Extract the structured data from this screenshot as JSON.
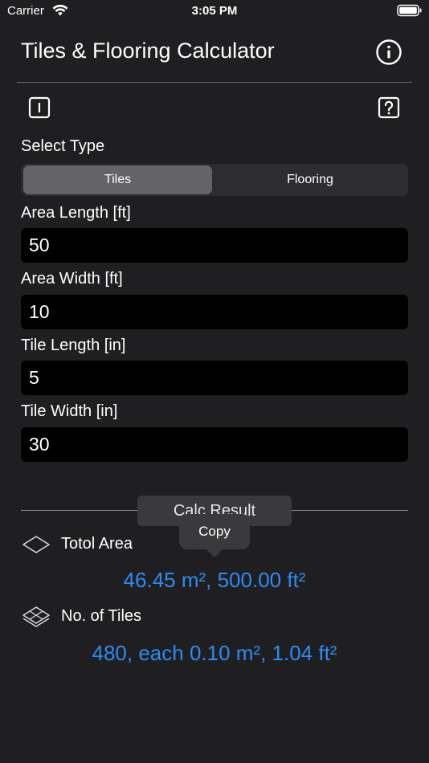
{
  "status_bar": {
    "carrier": "Carrier",
    "time": "3:05 PM"
  },
  "nav": {
    "title": "Tiles & Flooring Calculator",
    "info_icon": "info-icon"
  },
  "toolbar": {
    "left_icon": "text-cursor-box-icon",
    "right_icon": "question-box-icon"
  },
  "type_selector": {
    "label": "Select Type",
    "options": [
      "Tiles",
      "Flooring"
    ],
    "selected": "Tiles"
  },
  "fields": [
    {
      "label": "Area Length [ft]",
      "value": "50"
    },
    {
      "label": "Area Width [ft]",
      "value": "10"
    },
    {
      "label": "Tile Length [in]",
      "value": "5"
    },
    {
      "label": "Tile Width [in]",
      "value": "30"
    }
  ],
  "result": {
    "button_label": "Calc Result",
    "copy_tooltip": "Copy",
    "total_area_label": "Totol Area",
    "total_area_value": "46.45 m², 500.00 ft²",
    "tiles_label": "No. of Tiles",
    "tiles_value": "480, each 0.10 m², 1.04 ft²"
  },
  "colors": {
    "background": "#1f1f21",
    "accent_blue": "#2b8cf2",
    "field_bg": "#000000"
  }
}
